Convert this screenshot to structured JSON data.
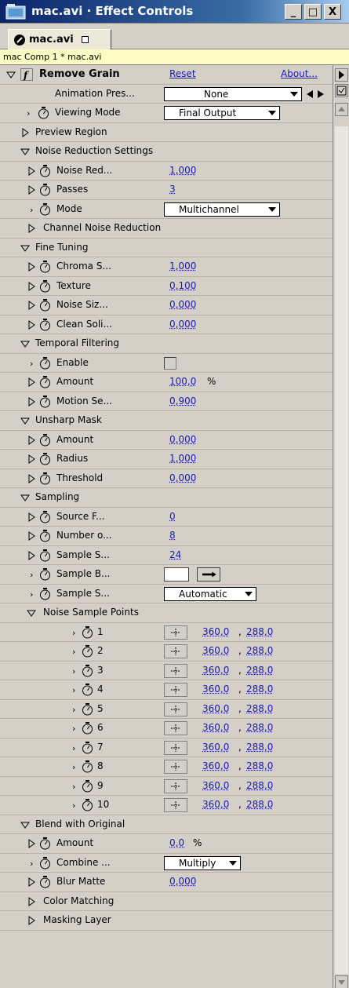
{
  "window": {
    "title": "mac.avi · Effect Controls",
    "minimize": "_",
    "maximize": "□",
    "close": "X"
  },
  "tab": {
    "label": "mac.avi"
  },
  "breadcrumb": "mac Comp 1 * mac.avi",
  "effect": {
    "name": "Remove Grain",
    "reset": "Reset",
    "about": "About...",
    "animation_presets_label": "Animation Pres...",
    "animation_presets_value": "None"
  },
  "rows": {
    "viewing_mode": {
      "label": "Viewing Mode",
      "value": "Final Output"
    },
    "preview_region": "Preview Region",
    "noise_reduction_settings": "Noise Reduction Settings",
    "noise_reduction": {
      "label": "Noise Red...",
      "value": "1,000"
    },
    "passes": {
      "label": "Passes",
      "value": "3"
    },
    "mode": {
      "label": "Mode",
      "value": "Multichannel"
    },
    "channel_noise_reduction": "Channel Noise Reduction",
    "fine_tuning": "Fine Tuning",
    "chroma": {
      "label": "Chroma S...",
      "value": "1,000"
    },
    "texture": {
      "label": "Texture",
      "value": "0,100"
    },
    "noise_size": {
      "label": "Noise Siz...",
      "value": "0,000"
    },
    "clean_solid": {
      "label": "Clean Soli...",
      "value": "0,000"
    },
    "temporal_filtering": "Temporal Filtering",
    "enable": {
      "label": "Enable"
    },
    "tf_amount": {
      "label": "Amount",
      "value": "100,0",
      "unit": "%"
    },
    "motion_sens": {
      "label": "Motion Se...",
      "value": "0,900"
    },
    "unsharp_mask": "Unsharp Mask",
    "um_amount": {
      "label": "Amount",
      "value": "0,000"
    },
    "um_radius": {
      "label": "Radius",
      "value": "1,000"
    },
    "um_threshold": {
      "label": "Threshold",
      "value": "0,000"
    },
    "sampling": "Sampling",
    "source_frame": {
      "label": "Source F...",
      "value": "0"
    },
    "number_of": {
      "label": "Number o...",
      "value": "8"
    },
    "sample_size": {
      "label": "Sample S...",
      "value": "24"
    },
    "sample_box": {
      "label": "Sample B..."
    },
    "sample_selection": {
      "label": "Sample S...",
      "value": "Automatic"
    },
    "noise_sample_points": "Noise Sample Points",
    "blend_with_original": "Blend with Original",
    "bo_amount": {
      "label": "Amount",
      "value": "0,0",
      "unit": "%"
    },
    "combine": {
      "label": "Combine ...",
      "value": "Multiply"
    },
    "blur_matte": {
      "label": "Blur Matte",
      "value": "0,000"
    },
    "color_matching": "Color Matching",
    "masking_layer": "Masking Layer"
  },
  "sample_points": [
    {
      "label": "1",
      "x": "360,0",
      "y": "288,0"
    },
    {
      "label": "2",
      "x": "360,0",
      "y": "288,0"
    },
    {
      "label": "3",
      "x": "360,0",
      "y": "288,0"
    },
    {
      "label": "4",
      "x": "360,0",
      "y": "288,0"
    },
    {
      "label": "5",
      "x": "360,0",
      "y": "288,0"
    },
    {
      "label": "6",
      "x": "360,0",
      "y": "288,0"
    },
    {
      "label": "7",
      "x": "360,0",
      "y": "288,0"
    },
    {
      "label": "8",
      "x": "360,0",
      "y": "288,0"
    },
    {
      "label": "9",
      "x": "360,0",
      "y": "288,0"
    },
    {
      "label": "10",
      "x": "360,0",
      "y": "288,0"
    }
  ],
  "colors": {
    "titlebar": "#0a246a",
    "value_link": "#1a1ab0",
    "breadcrumb_bg": "#fdfcc2"
  }
}
